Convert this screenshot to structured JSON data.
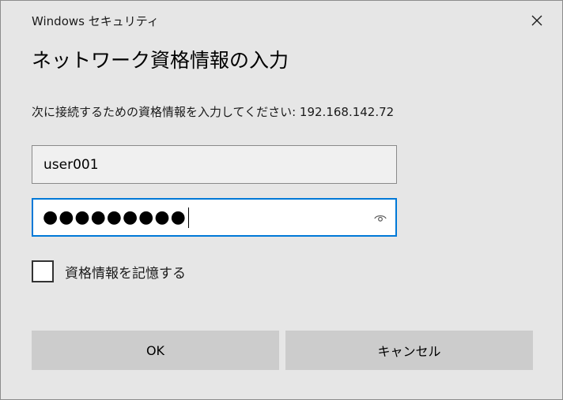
{
  "window": {
    "title": "Windows セキュリティ",
    "close_icon": "close-icon"
  },
  "heading": "ネットワーク資格情報の入力",
  "prompt": "次に接続するための資格情報を入力してください: 192.168.142.72",
  "username": {
    "value": "user001"
  },
  "password": {
    "masked_value": "●●●●●●●●●",
    "reveal_icon": "eye-icon",
    "focused": true
  },
  "remember": {
    "label": "資格情報を記憶する",
    "checked": false
  },
  "buttons": {
    "ok_label": "OK",
    "cancel_label": "キャンセル"
  },
  "colors": {
    "background": "#e6e6e6",
    "focus_border": "#0078d7",
    "button_bg": "#cccccc"
  }
}
